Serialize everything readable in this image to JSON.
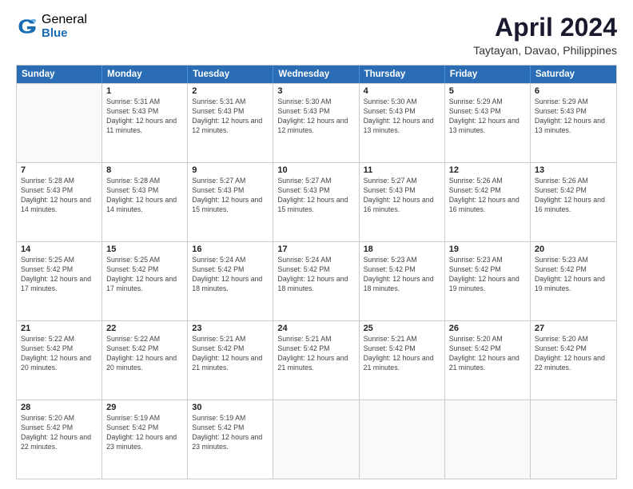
{
  "logo": {
    "general": "General",
    "blue": "Blue"
  },
  "title": "April 2024",
  "subtitle": "Taytayan, Davao, Philippines",
  "header_days": [
    "Sunday",
    "Monday",
    "Tuesday",
    "Wednesday",
    "Thursday",
    "Friday",
    "Saturday"
  ],
  "rows": [
    [
      {
        "date": "",
        "sunrise": "",
        "sunset": "",
        "daylight": ""
      },
      {
        "date": "1",
        "sunrise": "Sunrise: 5:31 AM",
        "sunset": "Sunset: 5:43 PM",
        "daylight": "Daylight: 12 hours and 11 minutes."
      },
      {
        "date": "2",
        "sunrise": "Sunrise: 5:31 AM",
        "sunset": "Sunset: 5:43 PM",
        "daylight": "Daylight: 12 hours and 12 minutes."
      },
      {
        "date": "3",
        "sunrise": "Sunrise: 5:30 AM",
        "sunset": "Sunset: 5:43 PM",
        "daylight": "Daylight: 12 hours and 12 minutes."
      },
      {
        "date": "4",
        "sunrise": "Sunrise: 5:30 AM",
        "sunset": "Sunset: 5:43 PM",
        "daylight": "Daylight: 12 hours and 13 minutes."
      },
      {
        "date": "5",
        "sunrise": "Sunrise: 5:29 AM",
        "sunset": "Sunset: 5:43 PM",
        "daylight": "Daylight: 12 hours and 13 minutes."
      },
      {
        "date": "6",
        "sunrise": "Sunrise: 5:29 AM",
        "sunset": "Sunset: 5:43 PM",
        "daylight": "Daylight: 12 hours and 13 minutes."
      }
    ],
    [
      {
        "date": "7",
        "sunrise": "Sunrise: 5:28 AM",
        "sunset": "Sunset: 5:43 PM",
        "daylight": "Daylight: 12 hours and 14 minutes."
      },
      {
        "date": "8",
        "sunrise": "Sunrise: 5:28 AM",
        "sunset": "Sunset: 5:43 PM",
        "daylight": "Daylight: 12 hours and 14 minutes."
      },
      {
        "date": "9",
        "sunrise": "Sunrise: 5:27 AM",
        "sunset": "Sunset: 5:43 PM",
        "daylight": "Daylight: 12 hours and 15 minutes."
      },
      {
        "date": "10",
        "sunrise": "Sunrise: 5:27 AM",
        "sunset": "Sunset: 5:43 PM",
        "daylight": "Daylight: 12 hours and 15 minutes."
      },
      {
        "date": "11",
        "sunrise": "Sunrise: 5:27 AM",
        "sunset": "Sunset: 5:43 PM",
        "daylight": "Daylight: 12 hours and 16 minutes."
      },
      {
        "date": "12",
        "sunrise": "Sunrise: 5:26 AM",
        "sunset": "Sunset: 5:42 PM",
        "daylight": "Daylight: 12 hours and 16 minutes."
      },
      {
        "date": "13",
        "sunrise": "Sunrise: 5:26 AM",
        "sunset": "Sunset: 5:42 PM",
        "daylight": "Daylight: 12 hours and 16 minutes."
      }
    ],
    [
      {
        "date": "14",
        "sunrise": "Sunrise: 5:25 AM",
        "sunset": "Sunset: 5:42 PM",
        "daylight": "Daylight: 12 hours and 17 minutes."
      },
      {
        "date": "15",
        "sunrise": "Sunrise: 5:25 AM",
        "sunset": "Sunset: 5:42 PM",
        "daylight": "Daylight: 12 hours and 17 minutes."
      },
      {
        "date": "16",
        "sunrise": "Sunrise: 5:24 AM",
        "sunset": "Sunset: 5:42 PM",
        "daylight": "Daylight: 12 hours and 18 minutes."
      },
      {
        "date": "17",
        "sunrise": "Sunrise: 5:24 AM",
        "sunset": "Sunset: 5:42 PM",
        "daylight": "Daylight: 12 hours and 18 minutes."
      },
      {
        "date": "18",
        "sunrise": "Sunrise: 5:23 AM",
        "sunset": "Sunset: 5:42 PM",
        "daylight": "Daylight: 12 hours and 18 minutes."
      },
      {
        "date": "19",
        "sunrise": "Sunrise: 5:23 AM",
        "sunset": "Sunset: 5:42 PM",
        "daylight": "Daylight: 12 hours and 19 minutes."
      },
      {
        "date": "20",
        "sunrise": "Sunrise: 5:23 AM",
        "sunset": "Sunset: 5:42 PM",
        "daylight": "Daylight: 12 hours and 19 minutes."
      }
    ],
    [
      {
        "date": "21",
        "sunrise": "Sunrise: 5:22 AM",
        "sunset": "Sunset: 5:42 PM",
        "daylight": "Daylight: 12 hours and 20 minutes."
      },
      {
        "date": "22",
        "sunrise": "Sunrise: 5:22 AM",
        "sunset": "Sunset: 5:42 PM",
        "daylight": "Daylight: 12 hours and 20 minutes."
      },
      {
        "date": "23",
        "sunrise": "Sunrise: 5:21 AM",
        "sunset": "Sunset: 5:42 PM",
        "daylight": "Daylight: 12 hours and 21 minutes."
      },
      {
        "date": "24",
        "sunrise": "Sunrise: 5:21 AM",
        "sunset": "Sunset: 5:42 PM",
        "daylight": "Daylight: 12 hours and 21 minutes."
      },
      {
        "date": "25",
        "sunrise": "Sunrise: 5:21 AM",
        "sunset": "Sunset: 5:42 PM",
        "daylight": "Daylight: 12 hours and 21 minutes."
      },
      {
        "date": "26",
        "sunrise": "Sunrise: 5:20 AM",
        "sunset": "Sunset: 5:42 PM",
        "daylight": "Daylight: 12 hours and 21 minutes."
      },
      {
        "date": "27",
        "sunrise": "Sunrise: 5:20 AM",
        "sunset": "Sunset: 5:42 PM",
        "daylight": "Daylight: 12 hours and 22 minutes."
      }
    ],
    [
      {
        "date": "28",
        "sunrise": "Sunrise: 5:20 AM",
        "sunset": "Sunset: 5:42 PM",
        "daylight": "Daylight: 12 hours and 22 minutes."
      },
      {
        "date": "29",
        "sunrise": "Sunrise: 5:19 AM",
        "sunset": "Sunset: 5:42 PM",
        "daylight": "Daylight: 12 hours and 23 minutes."
      },
      {
        "date": "30",
        "sunrise": "Sunrise: 5:19 AM",
        "sunset": "Sunset: 5:42 PM",
        "daylight": "Daylight: 12 hours and 23 minutes."
      },
      {
        "date": "",
        "sunrise": "",
        "sunset": "",
        "daylight": ""
      },
      {
        "date": "",
        "sunrise": "",
        "sunset": "",
        "daylight": ""
      },
      {
        "date": "",
        "sunrise": "",
        "sunset": "",
        "daylight": ""
      },
      {
        "date": "",
        "sunrise": "",
        "sunset": "",
        "daylight": ""
      }
    ]
  ]
}
